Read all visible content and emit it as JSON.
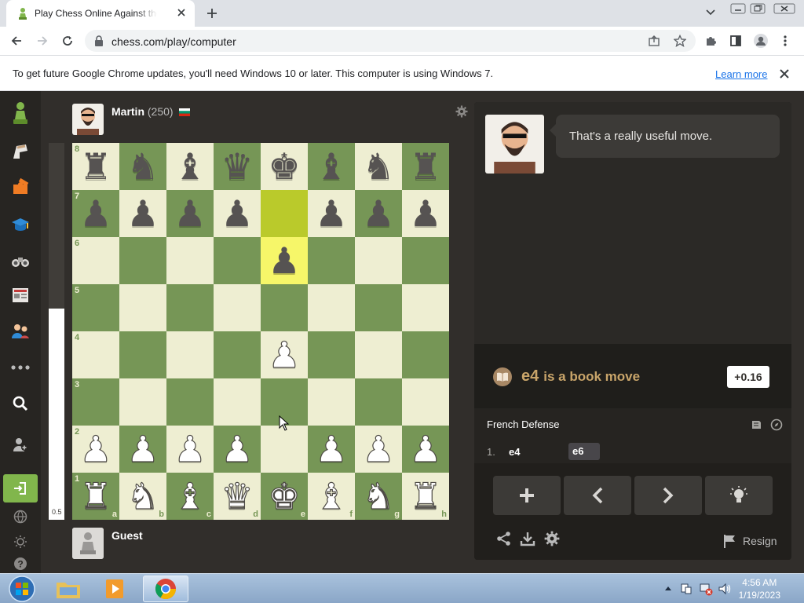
{
  "browser": {
    "tab_title": "Play Chess Online Against the Computer",
    "url": "chess.com/play/computer",
    "info_text": "To get future Google Chrome updates, you'll need Windows 10 or later. This computer is using Windows 7.",
    "info_link": "Learn more"
  },
  "game": {
    "opponent": {
      "name": "Martin",
      "rating": "(250)"
    },
    "player": {
      "name": "Guest"
    },
    "eval_bar_label": "0.5",
    "eval_white_fraction": 0.56,
    "board": {
      "rank_labels": [
        "8",
        "7",
        "6",
        "5",
        "4",
        "3",
        "2",
        "1"
      ],
      "file_labels": [
        "a",
        "b",
        "c",
        "d",
        "e",
        "f",
        "g",
        "h"
      ],
      "highlights": [
        "e7",
        "e6"
      ],
      "pieces": {
        "a8": "bR",
        "b8": "bN",
        "c8": "bB",
        "d8": "bQ",
        "e8": "bK",
        "f8": "bB",
        "g8": "bN",
        "h8": "bR",
        "a7": "bP",
        "b7": "bP",
        "c7": "bP",
        "d7": "bP",
        "f7": "bP",
        "g7": "bP",
        "h7": "bP",
        "e6": "bP",
        "e4": "wP",
        "a2": "wP",
        "b2": "wP",
        "c2": "wP",
        "d2": "wP",
        "f2": "wP",
        "g2": "wP",
        "h2": "wP",
        "a1": "wR",
        "b1": "wN",
        "c1": "wB",
        "d1": "wQ",
        "e1": "wK",
        "f1": "wB",
        "g1": "wN",
        "h1": "wR"
      }
    }
  },
  "panel": {
    "coach_message": "That's a really useful move.",
    "book_move": "e4",
    "book_text": "is a book move",
    "eval_score": "+0.16",
    "opening": "French Defense",
    "moves": {
      "number": "1.",
      "white": "e4",
      "black": "e6"
    },
    "resign_label": "Resign"
  },
  "taskbar": {
    "time": "4:56 AM",
    "date": "1/19/2023"
  },
  "colors": {
    "light_square": "#eeeed2",
    "dark_square": "#769656",
    "highlight_light": "#f6f669",
    "highlight_dark": "#baca2b",
    "accent_green": "#81b64c"
  }
}
